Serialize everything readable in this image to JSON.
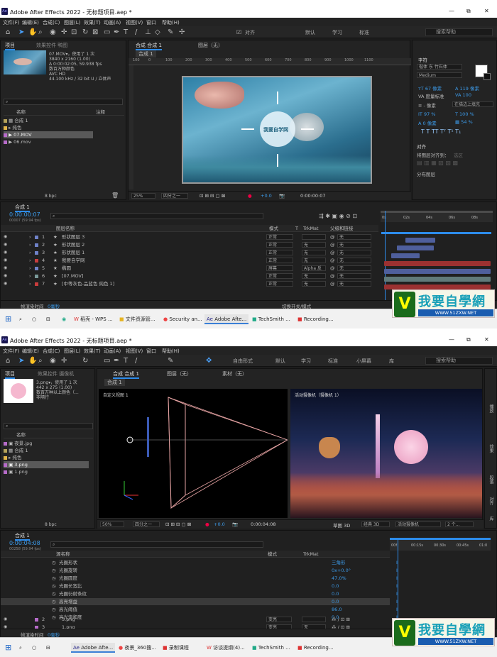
{
  "app": {
    "title1": "Adobe After Effects 2022 - 无标题项目.aep *",
    "title2": "Adobe After Effects 2022 - 无标题项目.aep *",
    "menu": [
      "文件(F)",
      "编辑(E)",
      "合成(C)",
      "图层(L)",
      "效果(T)",
      "动画(A)",
      "视图(V)",
      "窗口",
      "帮助(H)"
    ],
    "win_min": "—",
    "win_max": "⧉",
    "win_close": "✕"
  },
  "screen1": {
    "toolbar": {
      "snap": "对齐",
      "ws_default": "默认",
      "ws_learn": "学习",
      "ws_standard": "标准",
      "search": "搜索帮助"
    },
    "project": {
      "tab_project": "项目",
      "tab_effects": "效果控件 鸭图",
      "file_name": "07.MOV▾，使用了 1 次",
      "file_info": [
        "3840 x 2160 (1.00)",
        "Δ 0:00:02:05, 59.938 fps",
        "数百万种颜色",
        "AVC HD",
        "44.100 kHz / 32 bit U / 立体声"
      ],
      "col_name": "名称",
      "col_note": "注释",
      "items": [
        "合成 1",
        "纯色",
        "07.MOV",
        "06.mov"
      ],
      "bpc": "8 bpc"
    },
    "composition": {
      "tab": "合成 合成 1",
      "layer_tab": "图层（无）",
      "crumb": "合成 1",
      "ruler": [
        "100",
        "0",
        "100",
        "200",
        "300",
        "400",
        "500",
        "600",
        "700",
        "800",
        "900",
        "1000",
        "1100"
      ],
      "circle_text": "我要自学网",
      "zoom": "25%",
      "res": "四分之一",
      "exposure": "+0.0",
      "time": "0:00:00:07"
    },
    "character": {
      "title": "字符",
      "font": "楷体 东 竹石体",
      "style": "Medium",
      "size": "67 像素",
      "leading": "119 像素",
      "kern": "度量标准",
      "track": "100",
      "stroke": "- 像素",
      "stroke_mode": "在描边上填充",
      "scale_v": "97 %",
      "scale_h": "100 %",
      "baseline": "0 像素",
      "tsume": "54 %",
      "align_title": "对齐",
      "align_to": "将图层对齐到：",
      "align_sel": "选区",
      "dist": "分布图层"
    },
    "timeline": {
      "tab": "合成 1",
      "time": "0:00:00:07",
      "fps": "00007 (59.94 fps)",
      "col_layer": "图层名称",
      "col_mode": "模式",
      "col_t": "T",
      "col_trk": "TrkMat",
      "col_parent": "父级和链接",
      "ruler": [
        "0s",
        "02s",
        "04s",
        "06s",
        "08s"
      ],
      "layers": [
        {
          "num": "1",
          "name": "形状图层 3",
          "mode": "正常",
          "trk": "",
          "parent": "无",
          "color": "#6f82c8"
        },
        {
          "num": "2",
          "name": "形状图层 2",
          "mode": "正常",
          "trk": "无",
          "parent": "无",
          "color": "#6f82c8"
        },
        {
          "num": "3",
          "name": "形状图层 1",
          "mode": "正常",
          "trk": "无",
          "parent": "无",
          "color": "#6f82c8"
        },
        {
          "num": "4",
          "name": "我要自学网",
          "mode": "正常",
          "trk": "无",
          "parent": "无",
          "color": "#c83c3c"
        },
        {
          "num": "5",
          "name": "椭圆",
          "mode": "屏幕",
          "trk": "Alpha 反",
          "parent": "无",
          "color": "#6f82c8"
        },
        {
          "num": "6",
          "name": "[07.MOV]",
          "mode": "正常",
          "trk": "无",
          "parent": "无",
          "color": "#7a9a9a"
        },
        {
          "num": "7",
          "name": "[中等灰色-品蓝色 纯色 1]",
          "mode": "正常",
          "trk": "无",
          "parent": "无",
          "color": "#c83c3c"
        }
      ],
      "render": "帧渲染时间",
      "ms": "0毫秒",
      "toggle": "切换开关/模式"
    },
    "taskbar": [
      "稻壳 - WPS ...",
      "文件资源管...",
      "Security an...",
      "Adobe Afte...",
      "TechSmith ...",
      "Recording..."
    ]
  },
  "screen2": {
    "toolbar": {
      "mode": "自由形式",
      "ws_default": "默认",
      "ws_learn": "学习",
      "ws_standard": "标准",
      "ws_small": "小屏幕",
      "ws_lib": "库",
      "search": "搜索帮助"
    },
    "project": {
      "tab_project": "项目",
      "tab_effects": "效果控件 摄像机",
      "file_name": "3.png▾，使用了 1 次",
      "file_info": [
        "442 x 275 (1.00)",
        "",
        "数百万种以上颜色（...",
        "非隔行"
      ],
      "col_name": "名称",
      "items": [
        "夜景.jpg",
        "合成 1",
        "纯色",
        "3.png",
        "1.png"
      ],
      "bpc": "8 bpc"
    },
    "composition": {
      "tab": "合成 合成 1",
      "layer_tab": "图层（无）",
      "footage_tab": "素材（无）",
      "crumb": "合成 1",
      "left_label": "自定义视图 1",
      "right_label": "活动摄像机（摄像机 1）",
      "zoom": "50%",
      "res": "四分之一",
      "exposure": "+0.0",
      "time": "0:00:04:08",
      "draft": "草图 3D",
      "renderer": "经典 3D",
      "camera": "活动摄像机",
      "views": "2 个..."
    },
    "side": {
      "a": "播放",
      "b": "效果",
      "c": "段落",
      "d": "对齐",
      "e": "库"
    },
    "timeline": {
      "tab": "合成 1",
      "time": "0:00:04:08",
      "fps": "00258 (59.94 fps)",
      "col_layer": "源名称",
      "col_mode": "模式",
      "col_trk": "TrkMat",
      "ruler": [
        "00f",
        "00:15s",
        "00:30s",
        "00:45s",
        "01:0"
      ],
      "props": [
        {
          "name": "光圈形状",
          "value": "三角形"
        },
        {
          "name": "光圈旋转",
          "value": "0x+0.0°"
        },
        {
          "name": "光圈圆度",
          "value": "47.0%"
        },
        {
          "name": "光圈长宽比",
          "value": "0.0"
        },
        {
          "name": "光圈衍射条纹",
          "value": "0.0"
        },
        {
          "name": "高亮增益",
          "value": "0.0"
        },
        {
          "name": "高光阈值",
          "value": "86.0"
        },
        {
          "name": "高光饱和度",
          "value": "0.0"
        }
      ],
      "layers": [
        {
          "num": "2",
          "name": "3.png",
          "mode": "变亮",
          "trk": ""
        },
        {
          "num": "3",
          "name": "1.png",
          "mode": "变亮",
          "trk": "无"
        }
      ],
      "render": "帧渲染时间",
      "ms": "0毫秒"
    },
    "taskbar": [
      "Adobe Afte...",
      "夜景_360搜...",
      "录制课程",
      "访谈提纲(4)...",
      "TechSmith ...",
      "Recording..."
    ]
  },
  "watermark": {
    "big": "我要自學網",
    "url": "WWW.51ZXW.NET"
  },
  "colors": {
    "accent": "#2d8ceb",
    "panel": "#232323",
    "bg": "#1d1d1d"
  }
}
